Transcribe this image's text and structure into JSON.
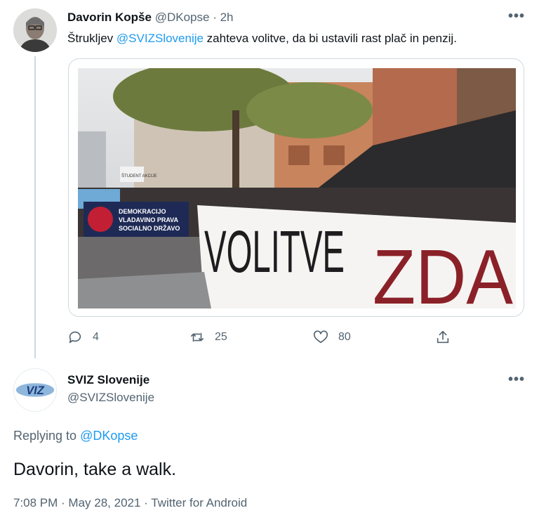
{
  "tweet1": {
    "name": "Davorin Kopše",
    "handle": "@DKopse",
    "separator": " · ",
    "time": "2h",
    "text_before": "Štrukljev ",
    "text_mention": "@SVIZSlovenije",
    "text_after": " zahteva volitve, da bi ustavili rast plač in penzij.",
    "more_icon": "•••",
    "media": {
      "banner_main": "VOLITVE",
      "banner_second": "ZDA",
      "banner_small": [
        "DEMOKRACIJO",
        "VLADAVINO PRAVA",
        "SOCIALNO DRŽAVO"
      ],
      "sign_left": "ŠTUDENT AKCIJE"
    },
    "replies": "4",
    "retweets": "25",
    "likes": "80"
  },
  "tweet2": {
    "name": "SVIZ Slovenije",
    "handle": "@SVIZSlovenije",
    "logo_text": "VIZ",
    "more_icon": "•••",
    "replying_label": "Replying to ",
    "replying_handle": "@DKopse",
    "text": "Davorin, take a walk.",
    "meta": "7:08 PM · May 28, 2021 · Twitter for Android"
  },
  "colors": {
    "accent": "#1d9bf0",
    "secondary_text": "#536471",
    "primary_text": "#0f1419",
    "thread_line": "#cfd9de"
  }
}
